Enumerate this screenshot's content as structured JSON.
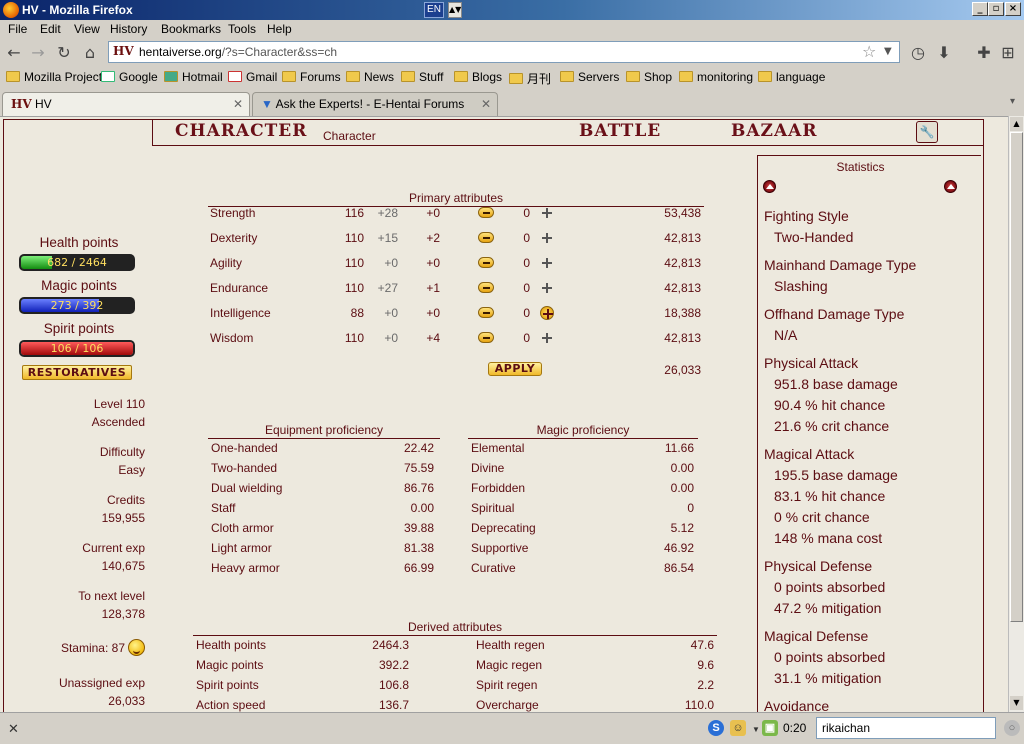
{
  "window": {
    "title": "HV - Mozilla Firefox",
    "lang_indicator": "EN"
  },
  "menu": [
    "File",
    "Edit",
    "View",
    "History",
    "Bookmarks",
    "Tools",
    "Help"
  ],
  "address": {
    "domain": "hentaiverse.org",
    "path": "/?s=Character&ss=ch",
    "favicon": "HV"
  },
  "bookmarks": [
    "Mozilla Project",
    "Google",
    "Hotmail",
    "Gmail",
    "Forums",
    "News",
    "Stuff",
    "Blogs",
    "月刊",
    "Servers",
    "Shop",
    "monitoring",
    "language"
  ],
  "tabs": [
    {
      "label": "HV",
      "active": true
    },
    {
      "label": "Ask the Experts! - E-Hentai Forums",
      "active": false
    }
  ],
  "nav": {
    "character": "CHARACTER",
    "character_sub": "Character",
    "battle": "BATTLE",
    "bazaar": "BAZAAR"
  },
  "vitals": {
    "health_label": "Health points",
    "health_value": "682 / 2464",
    "health_fraction": 0.277,
    "magic_label": "Magic points",
    "magic_value": "273 / 392",
    "magic_fraction": 0.696,
    "spirit_label": "Spirit points",
    "spirit_value": "106 / 106",
    "spirit_fraction": 1.0,
    "restoratives": "RESTORATIVES"
  },
  "profile": {
    "level": "Level 110",
    "rank": "Ascended",
    "difficulty_label": "Difficulty",
    "difficulty": "Easy",
    "credits_label": "Credits",
    "credits": "159,955",
    "current_exp_label": "Current exp",
    "current_exp": "140,675",
    "next_level_label": "To next level",
    "next_level": "128,378",
    "stamina": "Stamina: 87",
    "unassigned_label": "Unassigned exp",
    "unassigned": "26,033"
  },
  "primary": {
    "title": "Primary attributes",
    "rows": [
      {
        "name": "Strength",
        "base": "116",
        "bonus": "+28",
        "mod": "+0",
        "inc": "0",
        "cost": "53,438"
      },
      {
        "name": "Dexterity",
        "base": "110",
        "bonus": "+15",
        "mod": "+2",
        "inc": "0",
        "cost": "42,813"
      },
      {
        "name": "Agility",
        "base": "110",
        "bonus": "+0",
        "mod": "+0",
        "inc": "0",
        "cost": "42,813"
      },
      {
        "name": "Endurance",
        "base": "110",
        "bonus": "+27",
        "mod": "+1",
        "inc": "0",
        "cost": "42,813"
      },
      {
        "name": "Intelligence",
        "base": "88",
        "bonus": "+0",
        "mod": "+0",
        "inc": "0",
        "cost": "18,388"
      },
      {
        "name": "Wisdom",
        "base": "110",
        "bonus": "+0",
        "mod": "+4",
        "inc": "0",
        "cost": "42,813"
      }
    ],
    "apply": "APPLY",
    "remaining": "26,033"
  },
  "equipment": {
    "title": "Equipment proficiency",
    "rows": [
      {
        "name": "One-handed",
        "value": "22.42"
      },
      {
        "name": "Two-handed",
        "value": "75.59"
      },
      {
        "name": "Dual wielding",
        "value": "86.76"
      },
      {
        "name": "Staff",
        "value": "0.00"
      },
      {
        "name": "Cloth armor",
        "value": "39.88"
      },
      {
        "name": "Light armor",
        "value": "81.38"
      },
      {
        "name": "Heavy armor",
        "value": "66.99"
      }
    ]
  },
  "magic": {
    "title": "Magic proficiency",
    "rows": [
      {
        "name": "Elemental",
        "value": "11.66"
      },
      {
        "name": "Divine",
        "value": "0.00"
      },
      {
        "name": "Forbidden",
        "value": "0.00"
      },
      {
        "name": "Spiritual",
        "value": "0"
      },
      {
        "name": "Deprecating",
        "value": "5.12"
      },
      {
        "name": "Supportive",
        "value": "46.92"
      },
      {
        "name": "Curative",
        "value": "86.54"
      }
    ]
  },
  "derived": {
    "title": "Derived attributes",
    "rows": [
      {
        "l_name": "Health points",
        "l_value": "2464.3",
        "r_name": "Health regen",
        "r_value": "47.6"
      },
      {
        "l_name": "Magic points",
        "l_value": "392.2",
        "r_name": "Magic regen",
        "r_value": "9.6"
      },
      {
        "l_name": "Spirit points",
        "l_value": "106.8",
        "r_name": "Spirit regen",
        "r_value": "2.2"
      },
      {
        "l_name": "Action speed",
        "l_value": "136.7",
        "r_name": "Overcharge",
        "r_value": "110.0"
      }
    ]
  },
  "statistics": {
    "title": "Statistics",
    "items": [
      {
        "text": "Fighting Style",
        "sub": false
      },
      {
        "text": "Two-Handed",
        "sub": true
      },
      {
        "text": "Mainhand Damage Type",
        "sub": false
      },
      {
        "text": "Slashing",
        "sub": true
      },
      {
        "text": "Offhand Damage Type",
        "sub": false
      },
      {
        "text": "N/A",
        "sub": true
      },
      {
        "text": "Physical Attack",
        "sub": false
      },
      {
        "text": "951.8 base damage",
        "sub": true
      },
      {
        "text": "90.4 % hit chance",
        "sub": true
      },
      {
        "text": "21.6 % crit chance",
        "sub": true
      },
      {
        "text": "Magical Attack",
        "sub": false
      },
      {
        "text": "195.5 base damage",
        "sub": true
      },
      {
        "text": "83.1 % hit chance",
        "sub": true
      },
      {
        "text": "0 % crit chance",
        "sub": true
      },
      {
        "text": "148 % mana cost",
        "sub": true
      },
      {
        "text": "Physical Defense",
        "sub": false
      },
      {
        "text": "0 points absorbed",
        "sub": true
      },
      {
        "text": "47.2 % mitigation",
        "sub": true
      },
      {
        "text": "Magical Defense",
        "sub": false
      },
      {
        "text": "0 points absorbed",
        "sub": true
      },
      {
        "text": "31.1 % mitigation",
        "sub": true
      },
      {
        "text": "Avoidance",
        "sub": false
      }
    ]
  },
  "statusbar": {
    "time": "0:20",
    "search_value": "rikaichan"
  }
}
